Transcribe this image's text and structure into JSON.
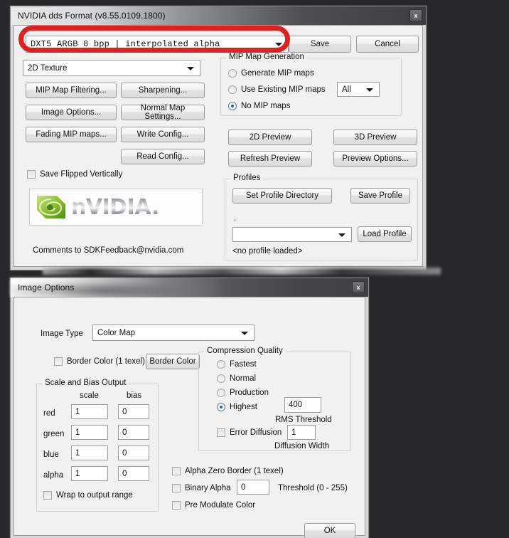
{
  "desktop": {
    "background": "#26282a"
  },
  "dds_window": {
    "title": "NVIDIA dds Format (v8.55.0109.1800)",
    "close_label": "x",
    "format_combo": {
      "value": "DXT5          ARGB   8 bpp | interpolated alpha"
    },
    "save_button": "Save",
    "cancel_button": "Cancel",
    "texture_type_combo": {
      "value": "2D Texture"
    },
    "buttons": [
      {
        "name": "mip-map-filtering",
        "label": "MIP Map Filtering..."
      },
      {
        "name": "sharpening",
        "label": "Sharpening..."
      },
      {
        "name": "image-options",
        "label": "Image Options..."
      },
      {
        "name": "normal-map-settings",
        "label": "Normal Map Settings..."
      },
      {
        "name": "fading-mip-maps",
        "label": "Fading MIP maps..."
      },
      {
        "name": "write-config",
        "label": "Write Config..."
      },
      {
        "name": "read-config",
        "label": "Read Config..."
      }
    ],
    "save_flipped_checkbox": "Save Flipped Vertically",
    "logo": {
      "wordmark": "nVIDIA",
      "period": "."
    },
    "comments_text": "Comments to SDKFeedback@nvidia.com",
    "mip_group": {
      "legend": "MIP Map Generation",
      "radios": [
        {
          "label": "Generate MIP maps",
          "selected": false
        },
        {
          "label": "Use Existing MIP maps",
          "selected": false
        },
        {
          "label": "No MIP maps",
          "selected": true
        }
      ],
      "existing_combo": {
        "value": "All"
      }
    },
    "preview_buttons": [
      {
        "name": "2d-preview",
        "label": "2D Preview"
      },
      {
        "name": "3d-preview",
        "label": "3D Preview"
      },
      {
        "name": "refresh-preview",
        "label": "Refresh Preview"
      },
      {
        "name": "preview-options",
        "label": "Preview Options..."
      }
    ],
    "profiles_group": {
      "legend": "Profiles",
      "set_profile_directory": "Set Profile Directory",
      "save_profile": "Save Profile",
      "dot_marker": ".",
      "profile_combo": {
        "value": ""
      },
      "load_profile": "Load Profile",
      "status": "<no profile loaded>"
    }
  },
  "image_options_window": {
    "title": "Image Options",
    "close_label": "x",
    "image_type_label": "Image Type",
    "image_type_combo": {
      "value": "Color Map"
    },
    "border_color_checkbox": "Border Color (1 texel)",
    "border_color_button": "Border Color",
    "scale_bias_group": {
      "legend": "Scale and Bias Output",
      "col_scale": "scale",
      "col_bias": "bias",
      "rows": [
        {
          "label": "red",
          "scale": "1",
          "bias": "0"
        },
        {
          "label": "green",
          "scale": "1",
          "bias": "0"
        },
        {
          "label": "blue",
          "scale": "1",
          "bias": "0"
        },
        {
          "label": "alpha",
          "scale": "1",
          "bias": "0"
        }
      ],
      "wrap_checkbox": "Wrap to output range"
    },
    "compression_group": {
      "legend": "Compression Quality",
      "radios": [
        {
          "label": "Fastest",
          "selected": false
        },
        {
          "label": "Normal",
          "selected": false
        },
        {
          "label": "Production",
          "selected": false
        },
        {
          "label": "Highest",
          "selected": true
        }
      ],
      "rms_value": "400",
      "rms_label": "RMS Threshold",
      "error_diffusion_checkbox": "Error Diffusion",
      "diffusion_value": "1",
      "diffusion_label": "Diffusion Width"
    },
    "alpha_zero_border_checkbox": "Alpha Zero Border (1 texel)",
    "binary_alpha_checkbox": "Binary Alpha",
    "binary_alpha_value": "0",
    "threshold_label": "Threshold (0 - 255)",
    "pre_modulate_checkbox": "Pre Modulate Color",
    "ok_button": "OK"
  },
  "annotation": {
    "color": "#e02020",
    "shape": "oval"
  }
}
